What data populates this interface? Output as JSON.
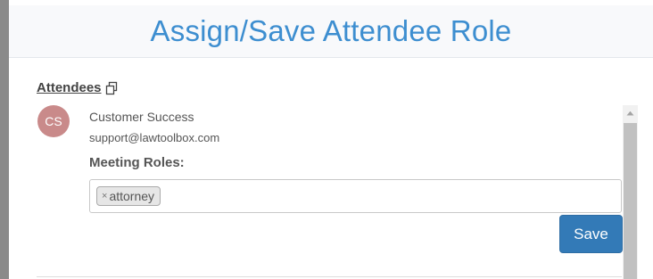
{
  "modal": {
    "title": "Assign/Save Attendee Role"
  },
  "attendees": {
    "heading": "Attendees",
    "copy_icon": "copy-icon",
    "items": [
      {
        "initials": "CS",
        "name": "Customer Success",
        "email": "support@lawtoolbox.com",
        "roles_label": "Meeting Roles:",
        "roles": [
          {
            "remove_glyph": "×",
            "label": "attorney"
          }
        ],
        "save_label": "Save"
      }
    ]
  },
  "colors": {
    "title": "#3d8ed0",
    "avatar": "#c98a8a",
    "save_button": "#337ab7"
  }
}
